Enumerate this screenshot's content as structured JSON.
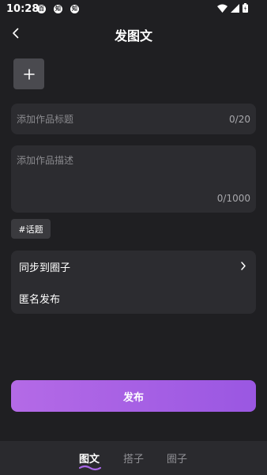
{
  "status_bar": {
    "time": "10:28",
    "notif_icons": [
      "百",
      "知",
      "知"
    ]
  },
  "header": {
    "title": "发图文"
  },
  "form": {
    "title_placeholder": "添加作品标题",
    "title_counter": "0/20",
    "desc_placeholder": "添加作品描述",
    "desc_counter": "0/1000",
    "topic_label": "#话题"
  },
  "options": {
    "sync_label": "同步到圈子",
    "anonymous_label": "匿名发布"
  },
  "publish_label": "发布",
  "tabs": [
    {
      "label": "图文",
      "active": true
    },
    {
      "label": "搭子",
      "active": false
    },
    {
      "label": "圈子",
      "active": false
    }
  ],
  "colors": {
    "background": "#1f1f22",
    "card": "#2c2c30",
    "accent_start": "#b46ae6",
    "accent_end": "#9a57e2"
  }
}
